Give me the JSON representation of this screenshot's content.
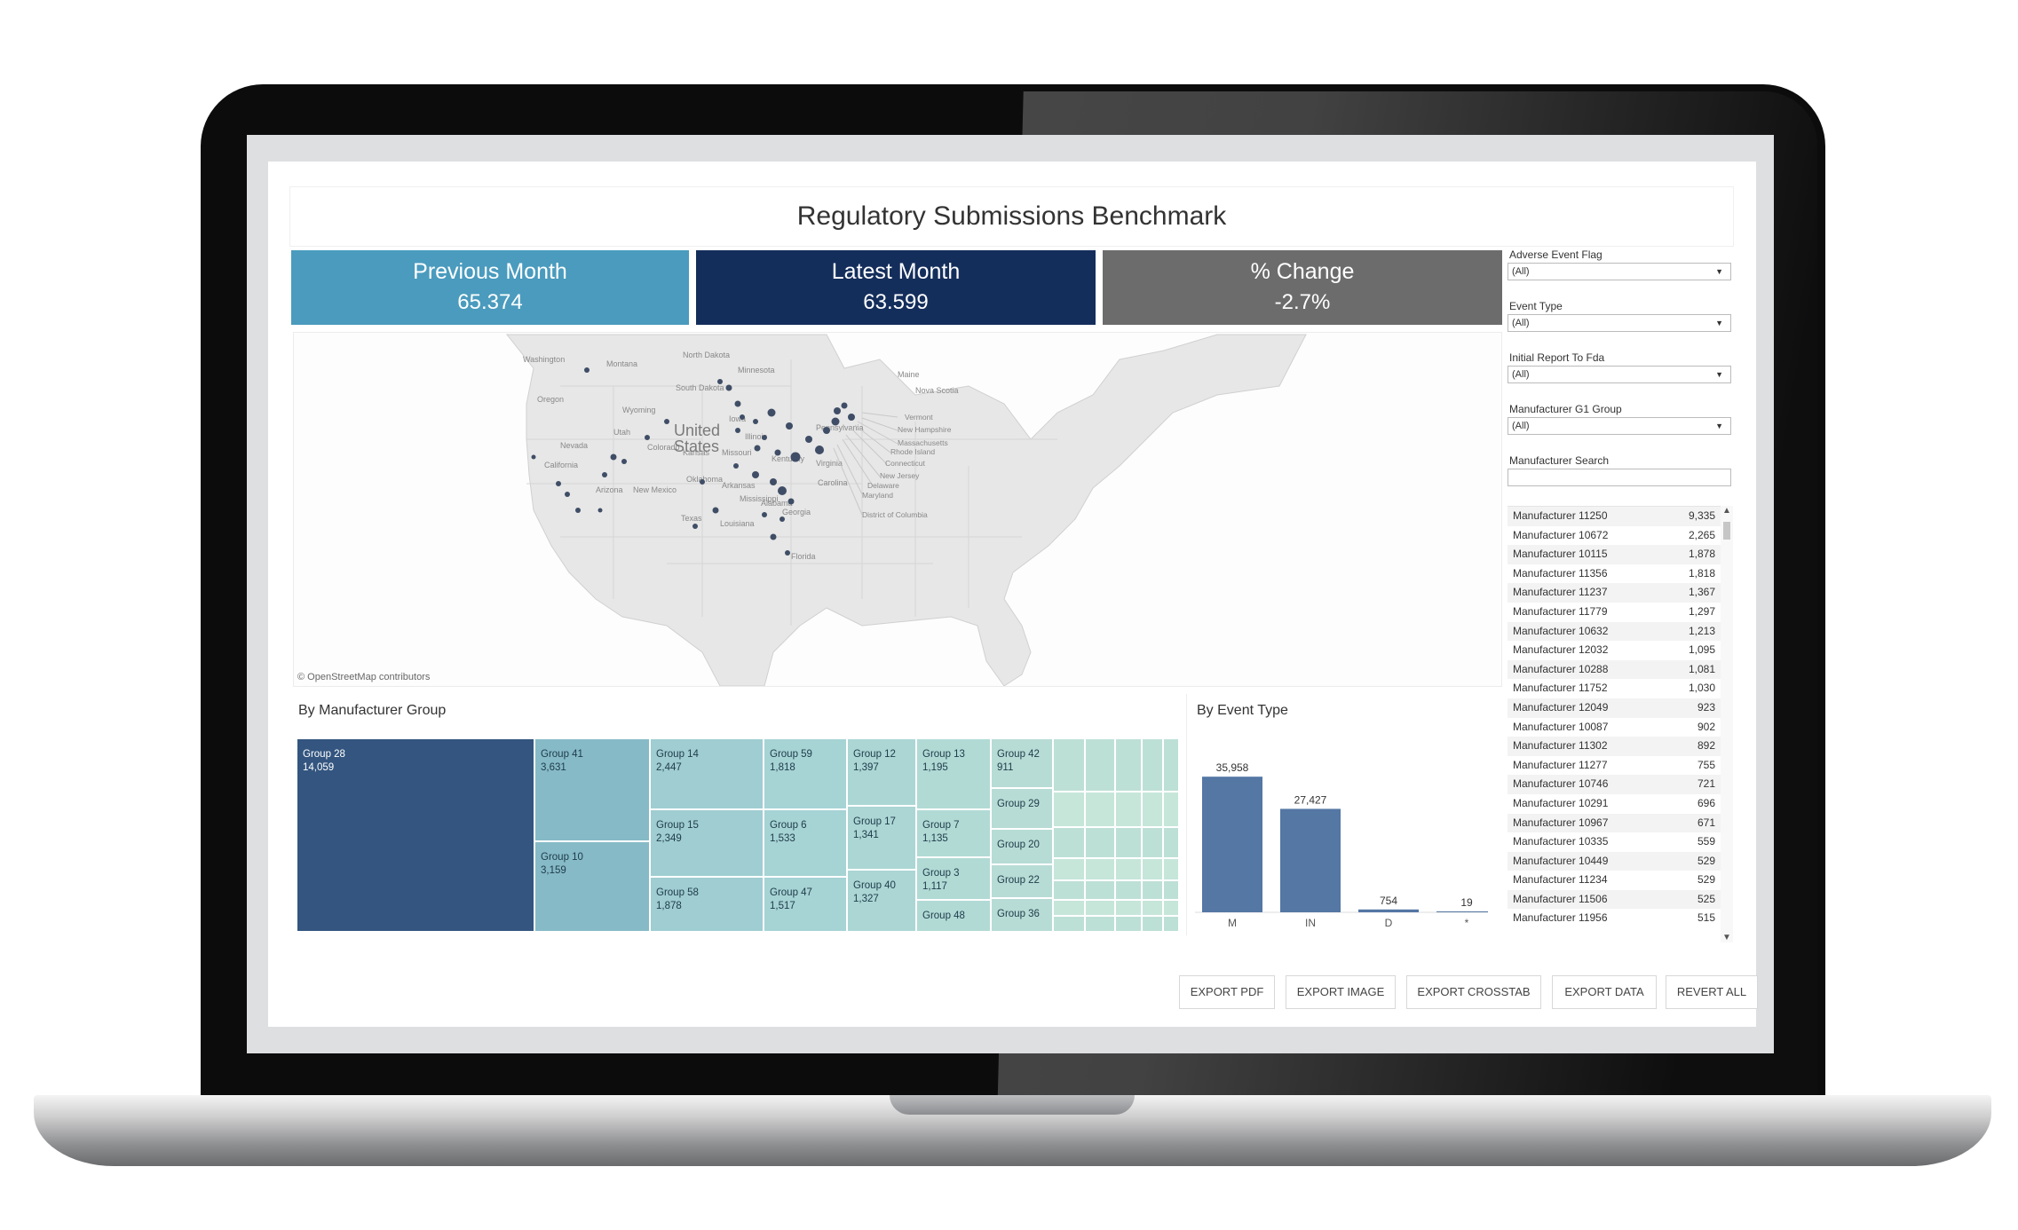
{
  "dashboard": {
    "title": "Regulatory Submissions Benchmark",
    "kpis": {
      "previous": {
        "label": "Previous Month",
        "value": "65.374"
      },
      "latest": {
        "label": "Latest Month",
        "value": "63.599"
      },
      "change": {
        "label": "% Change",
        "value": "-2.7%"
      }
    },
    "map": {
      "attribution": "© OpenStreetMap contributors",
      "country_label_1": "United",
      "country_label_2": "States",
      "states": [
        "Washington",
        "Montana",
        "North Dakota",
        "Minnesota",
        "South Dakota",
        "Oregon",
        "Wyoming",
        "Iowa",
        "Nevada",
        "Utah",
        "Colorado",
        "Kansas",
        "California",
        "Arizona",
        "New Mexico",
        "Oklahoma",
        "Texas",
        "Louisiana",
        "Georgia",
        "Florida",
        "Kentucky",
        "Pennsylvania",
        "Illinois",
        "Missouri",
        "Arkansas",
        "Mississippi",
        "Alabama",
        "Carolina",
        "Virginia",
        "Maine",
        "Nova Scotia"
      ],
      "callouts": [
        "Vermont",
        "New Hampshire",
        "Massachusetts",
        "Rhode Island",
        "Connecticut",
        "New Jersey",
        "Delaware",
        "Maryland",
        "District of Columbia"
      ]
    },
    "filters": [
      {
        "label": "Adverse Event Flag",
        "value": "(All)"
      },
      {
        "label": "Event Type",
        "value": "(All)"
      },
      {
        "label": "Initial Report To Fda",
        "value": "(All)"
      },
      {
        "label": "Manufacturer G1 Group",
        "value": "(All)"
      }
    ],
    "search_label": "Manufacturer Search",
    "manufacturers": [
      {
        "name": "Manufacturer 11250",
        "value": "9,335"
      },
      {
        "name": "Manufacturer 10672",
        "value": "2,265"
      },
      {
        "name": "Manufacturer 10115",
        "value": "1,878"
      },
      {
        "name": "Manufacturer 11356",
        "value": "1,818"
      },
      {
        "name": "Manufacturer 11237",
        "value": "1,367"
      },
      {
        "name": "Manufacturer 11779",
        "value": "1,297"
      },
      {
        "name": "Manufacturer 10632",
        "value": "1,213"
      },
      {
        "name": "Manufacturer 12032",
        "value": "1,095"
      },
      {
        "name": "Manufacturer 10288",
        "value": "1,081"
      },
      {
        "name": "Manufacturer 11752",
        "value": "1,030"
      },
      {
        "name": "Manufacturer 12049",
        "value": "923"
      },
      {
        "name": "Manufacturer 10087",
        "value": "902"
      },
      {
        "name": "Manufacturer 11302",
        "value": "892"
      },
      {
        "name": "Manufacturer 11277",
        "value": "755"
      },
      {
        "name": "Manufacturer 10746",
        "value": "721"
      },
      {
        "name": "Manufacturer 10291",
        "value": "696"
      },
      {
        "name": "Manufacturer 10967",
        "value": "671"
      },
      {
        "name": "Manufacturer 10335",
        "value": "559"
      },
      {
        "name": "Manufacturer 10449",
        "value": "529"
      },
      {
        "name": "Manufacturer 11234",
        "value": "529"
      },
      {
        "name": "Manufacturer 11506",
        "value": "525"
      },
      {
        "name": "Manufacturer 11956",
        "value": "515"
      }
    ],
    "treemap_title": "By Manufacturer Group",
    "groups": [
      {
        "name": "Group 28",
        "value": "14,059"
      },
      {
        "name": "Group 41",
        "value": "3,631"
      },
      {
        "name": "Group 10",
        "value": "3,159"
      },
      {
        "name": "Group 14",
        "value": "2,447"
      },
      {
        "name": "Group 15",
        "value": "2,349"
      },
      {
        "name": "Group 58",
        "value": "1,878"
      },
      {
        "name": "Group 59",
        "value": "1,818"
      },
      {
        "name": "Group 6",
        "value": "1,533"
      },
      {
        "name": "Group 47",
        "value": "1,517"
      },
      {
        "name": "Group 12",
        "value": "1,397"
      },
      {
        "name": "Group 17",
        "value": "1,341"
      },
      {
        "name": "Group 40",
        "value": "1,327"
      },
      {
        "name": "Group 13",
        "value": "1,195"
      },
      {
        "name": "Group 7",
        "value": "1,135"
      },
      {
        "name": "Group 3",
        "value": "1,117"
      },
      {
        "name": "Group 48",
        "value": ""
      },
      {
        "name": "Group 42",
        "value": "911"
      },
      {
        "name": "Group 29",
        "value": ""
      },
      {
        "name": "Group 20",
        "value": ""
      },
      {
        "name": "Group 22",
        "value": ""
      },
      {
        "name": "Group 36",
        "value": ""
      }
    ],
    "bar_title": "By Event Type",
    "buttons": [
      "EXPORT PDF",
      "EXPORT IMAGE",
      "EXPORT CROSSTAB",
      "EXPORT DATA",
      "REVERT ALL"
    ],
    "colors": {
      "previous": "#4a9bbe",
      "latest": "#142e5c",
      "change": "#6c6c6c",
      "bar": "#5477a4",
      "treemap_dark": "#33557f"
    }
  },
  "chart_data": {
    "type": "bar",
    "title": "By Event Type",
    "categories": [
      "M",
      "IN",
      "D",
      "*"
    ],
    "values": [
      35958,
      27427,
      754,
      19
    ],
    "value_labels": [
      "35,958",
      "27,427",
      "754",
      "19"
    ],
    "ylim": [
      0,
      40000
    ]
  }
}
